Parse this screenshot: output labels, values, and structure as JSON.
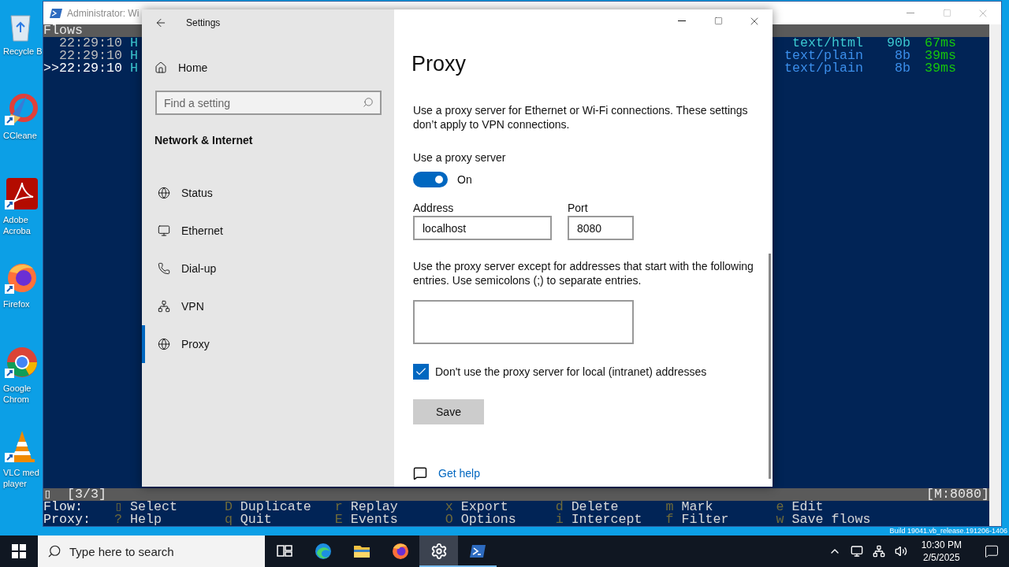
{
  "desktop": {
    "icons": [
      {
        "kind": "recycle",
        "lines": [
          "Recycle B"
        ]
      },
      {
        "kind": "ccleaner",
        "lines": [
          "CCleane"
        ]
      },
      {
        "kind": "acrobat",
        "lines": [
          "Adobe",
          "Acroba"
        ]
      },
      {
        "kind": "firefox",
        "lines": [
          "Firefox"
        ]
      },
      {
        "kind": "chrome",
        "lines": [
          "Google",
          "Chrom"
        ]
      },
      {
        "kind": "vlc",
        "lines": [
          "VLC med",
          "player"
        ]
      }
    ],
    "build_text": "Build 19041.vb_release.191206-1406"
  },
  "terminal": {
    "title": "Administrator: Wi",
    "header": "Flows",
    "cursor": ">>",
    "flows": [
      {
        "time": "22:29:10",
        "method": "H",
        "content_type": "text/html",
        "size": "90b",
        "duration": "67ms",
        "color": "#3cc8d0",
        "selected": false
      },
      {
        "time": "22:29:10",
        "method": "H",
        "content_type": "text/plain",
        "size": "8b",
        "duration": "39ms",
        "color": "#3b8eea",
        "selected": false
      },
      {
        "time": "22:29:10",
        "method": "H",
        "content_type": "text/plain",
        "size": "8b",
        "duration": "39ms",
        "color": "#3b8eea",
        "selected": true
      }
    ],
    "status_left": "▯  [3/3]",
    "status_right": "[M:8080]",
    "keybindings": [
      {
        "label": "Flow:",
        "keys": [
          {
            "key": "▯",
            "action": "Select"
          },
          {
            "key": "D",
            "action": "Duplicate"
          },
          {
            "key": "r",
            "action": "Replay"
          },
          {
            "key": "x",
            "action": "Export"
          },
          {
            "key": "d",
            "action": "Delete"
          },
          {
            "key": "m",
            "action": "Mark"
          },
          {
            "key": "e",
            "action": "Edit"
          }
        ]
      },
      {
        "label": "Proxy:",
        "keys": [
          {
            "key": "?",
            "action": "Help"
          },
          {
            "key": "q",
            "action": "Quit"
          },
          {
            "key": "E",
            "action": "Events"
          },
          {
            "key": "O",
            "action": "Options"
          },
          {
            "key": "i",
            "action": "Intercept"
          },
          {
            "key": "f",
            "action": "Filter"
          },
          {
            "key": "w",
            "action": "Save flows"
          }
        ]
      }
    ]
  },
  "settings": {
    "title": "Settings",
    "home": "Home",
    "search_placeholder": "Find a setting",
    "section": "Network & Internet",
    "nav": [
      {
        "kind": "status",
        "label": "Status",
        "selected": false
      },
      {
        "kind": "ethernet",
        "label": "Ethernet",
        "selected": false
      },
      {
        "kind": "dialup",
        "label": "Dial-up",
        "selected": false
      },
      {
        "kind": "vpn",
        "label": "VPN",
        "selected": false
      },
      {
        "kind": "proxy",
        "label": "Proxy",
        "selected": true
      }
    ],
    "page": {
      "title": "Proxy",
      "description": "Use a proxy server for Ethernet or Wi-Fi connections. These settings don’t apply to VPN connections.",
      "toggle": {
        "label": "Use a proxy server",
        "on": true,
        "state_text": "On"
      },
      "address": {
        "label": "Address",
        "value": "localhost"
      },
      "port": {
        "label": "Port",
        "value": "8080"
      },
      "exceptions_text": "Use the proxy server except for addresses that start with the following entries. Use semicolons (;) to separate entries.",
      "bypass_local": {
        "label": "Don't use the proxy server for local (intranet) addresses",
        "checked": true
      },
      "save": "Save",
      "help": "Get help"
    }
  },
  "taskbar": {
    "search_placeholder": "Type here to search",
    "apps": [
      {
        "kind": "taskview",
        "active": false,
        "running": false
      },
      {
        "kind": "edge",
        "active": false,
        "running": false
      },
      {
        "kind": "explorer",
        "active": false,
        "running": false
      },
      {
        "kind": "firefox",
        "active": false,
        "running": false
      },
      {
        "kind": "settings",
        "active": true,
        "running": true
      },
      {
        "kind": "powershell",
        "active": false,
        "running": true
      }
    ],
    "time": "10:30 PM",
    "date": "2/5/2025"
  }
}
